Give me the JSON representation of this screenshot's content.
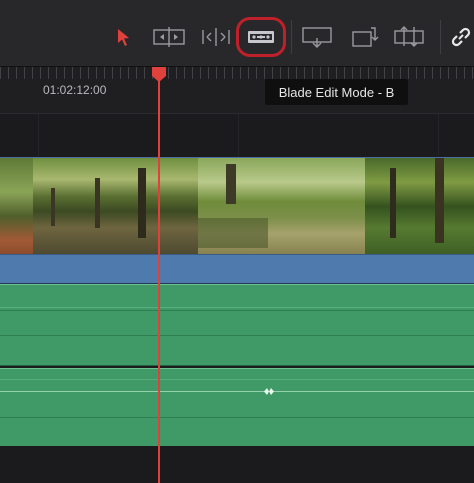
{
  "toolbar": {
    "tools": [
      {
        "name": "selection-mode",
        "icon": "arrow-pointer-icon"
      },
      {
        "name": "trim-edit-mode",
        "icon": "trim-icon"
      },
      {
        "name": "dynamic-trim-mode",
        "icon": "dynamic-trim-icon"
      },
      {
        "name": "blade-edit-mode",
        "icon": "razor-blade-icon",
        "highlighted": true
      },
      {
        "name": "insert-clip",
        "icon": "insert-icon"
      },
      {
        "name": "overwrite-clip",
        "icon": "overwrite-icon"
      },
      {
        "name": "replace-clip",
        "icon": "replace-icon"
      },
      {
        "name": "link-toggle",
        "icon": "link-icon"
      }
    ],
    "accent_color": "#e0413c",
    "highlight_ring_color": "#c0202a"
  },
  "ruler": {
    "timecode": "01:02:12:00"
  },
  "tooltip": {
    "text": "Blade Edit Mode - B"
  },
  "tracks": {
    "video_color": "#4f7aae",
    "audio_color": "#3f9a68"
  }
}
